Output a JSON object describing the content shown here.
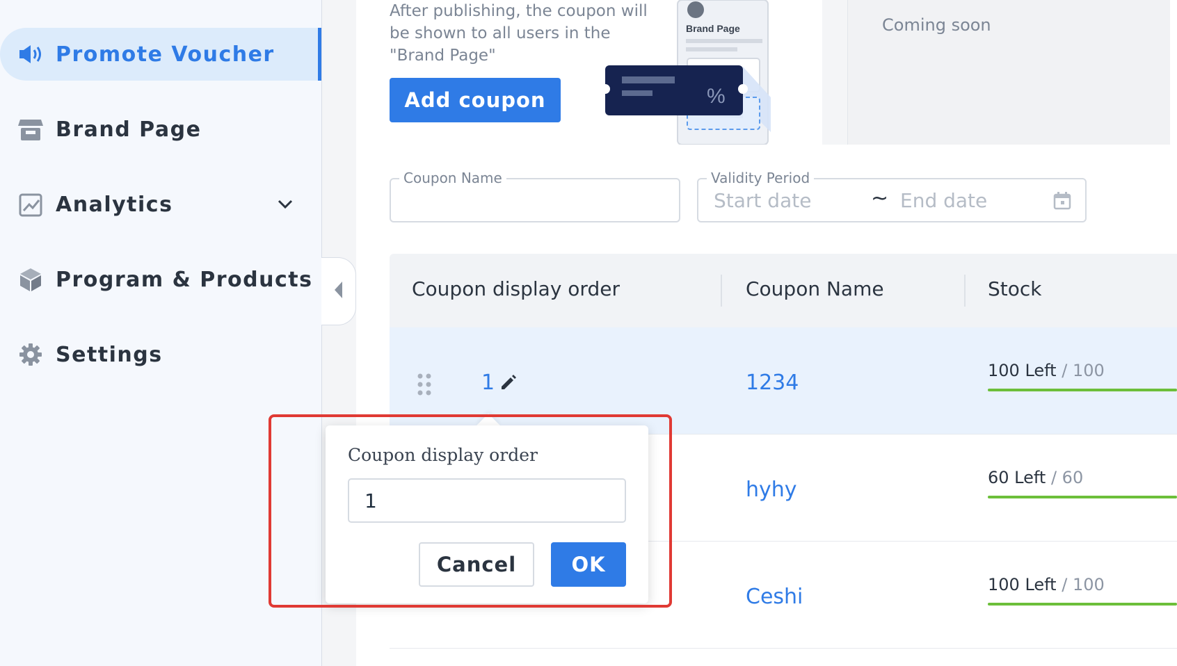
{
  "sidebar": {
    "items": [
      {
        "label": "Promote Voucher",
        "icon": "megaphone-icon",
        "active": true
      },
      {
        "label": "Brand Page",
        "icon": "store-icon"
      },
      {
        "label": "Analytics",
        "icon": "chart-icon",
        "expandable": true
      },
      {
        "label": "Program & Products",
        "icon": "box-icon"
      },
      {
        "label": "Settings",
        "icon": "gear-icon"
      }
    ]
  },
  "promo": {
    "description": "After publishing, the coupon will be shown to all users in the \"Brand Page\"",
    "add_button": "Add coupon",
    "illustration_label": "Brand Page",
    "illustration_symbol": "%"
  },
  "second_card": {
    "status": "Coming soon"
  },
  "filters": {
    "coupon_name_label": "Coupon Name",
    "coupon_name_value": "",
    "validity_label": "Validity Period",
    "start_placeholder": "Start date",
    "separator": "~",
    "end_placeholder": "End date"
  },
  "table": {
    "columns": [
      "Coupon display order",
      "Coupon Name",
      "Stock"
    ],
    "rows": [
      {
        "order": "1",
        "name": "1234",
        "stock_left": "100 Left",
        "stock_total": " / 100",
        "stock_fill": 1.0
      },
      {
        "order": "",
        "name": "hyhy",
        "stock_left": "60 Left",
        "stock_total": " / 60",
        "stock_fill": 1.0
      },
      {
        "order": "",
        "name": "Ceshi",
        "stock_left": "100 Left",
        "stock_total": " / 100",
        "stock_fill": 1.0
      }
    ]
  },
  "popover": {
    "title": "Coupon display order",
    "input_value": "1",
    "cancel_label": "Cancel",
    "ok_label": "OK"
  },
  "colors": {
    "accent": "#2f7be6",
    "highlight": "#e03a34",
    "stock_bar": "#6cbf3a"
  }
}
